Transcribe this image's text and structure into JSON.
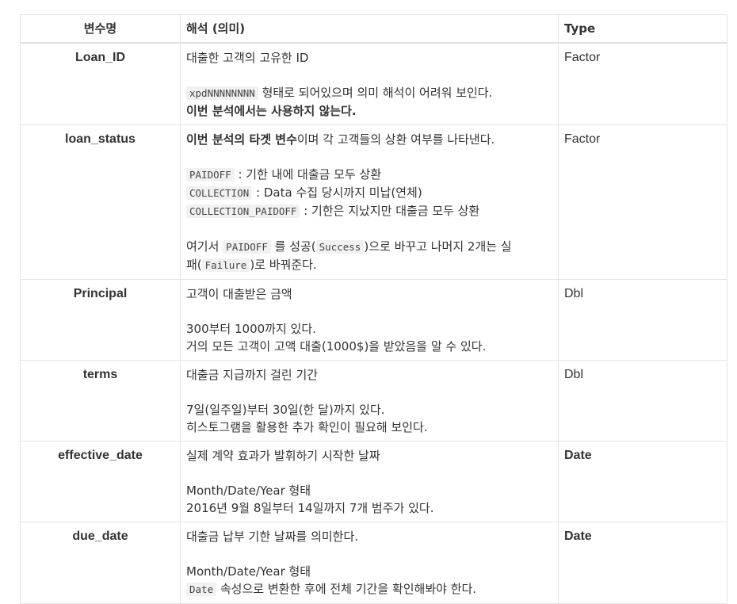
{
  "header": {
    "col_var": "변수명",
    "col_desc": "해석 (의미)",
    "col_type": "Type"
  },
  "rows": [
    {
      "name": "Loan_ID",
      "type": "Factor",
      "desc": {
        "l1": "대출한 고객의 고유한 ID",
        "l2_code": "xpdNNNNNNNN",
        "l2_text": " 형태로 되어있으며 의미 해석이 어려워 보인다.",
        "l3_bold": "이번 분석에서는 사용하지 않는다."
      }
    },
    {
      "name": "loan_status",
      "type": "Factor",
      "desc": {
        "l1_bold": "이번 분석의 타겟 변수",
        "l1_text": "이며 각 고객들의 상환 여부를 나타낸다.",
        "paidoff_code": "PAIDOFF",
        "paidoff_text": " : 기한 내에 대출금 모두 상환",
        "collection_code": "COLLECTION",
        "collection_text": " : Data 수집 당시까지 미납(연체)",
        "collection_paidoff_code": "COLLECTION_PAIDOFF",
        "collection_paidoff_text": " : 기한은 지났지만 대출금 모두 상환",
        "p1": "여기서 ",
        "p1_code": "PAIDOFF",
        "p2": " 를 성공(",
        "p2_code": "Success",
        "p3": ")으로 바꾸고 나머지 2개는 실",
        "p4": "패(",
        "p4_code": "Failure",
        "p5": ")로 바꿔준다."
      }
    },
    {
      "name": "Principal",
      "type": "Dbl",
      "desc": {
        "l1": "고객이 대출받은 금액",
        "l2": "300부터 1000까지 있다.",
        "l3": "거의 모든 고객이 고액 대출(1000$)을 받았음을 알 수 있다."
      }
    },
    {
      "name": "terms",
      "type": "Dbl",
      "desc": {
        "l1": "대출금 지급까지 걸린 기간",
        "l2": "7일(일주일)부터 30일(한 달)까지 있다.",
        "l3": "히스토그램을 활용한 추가 확인이 필요해 보인다."
      }
    },
    {
      "name": "effective_date",
      "type": "Date",
      "desc": {
        "l1": "실제 계약 효과가 발휘하기 시작한 날짜",
        "l2": "Month/Date/Year 형태",
        "l3": "2016년 9월 8일부터 14일까지 7개 범주가 있다."
      }
    },
    {
      "name": "due_date",
      "type": "Date",
      "desc": {
        "l1": "대출금 납부 기한 날짜를 의미한다.",
        "l2": "Month/Date/Year 형태",
        "l3_code": "Date",
        "l3_text": " 속성으로 변환한 후에 전체 기간을 확인해봐야 한다."
      }
    }
  ]
}
